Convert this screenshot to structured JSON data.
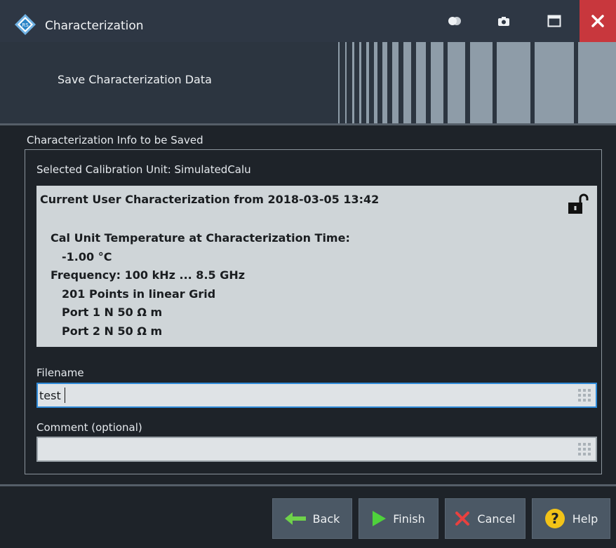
{
  "window": {
    "title": "Characterization",
    "controls": [
      "toggle-icon",
      "camera-icon",
      "maximize-icon",
      "close-icon"
    ],
    "close_color": "#c8373d"
  },
  "wizard": {
    "step_title": "Save Characterization Data"
  },
  "group": {
    "title": "Characterization Info to be Saved",
    "calibration_unit": "Selected Calibration Unit: SimulatedCalu",
    "info": {
      "heading": "Current User Characterization from 2018-03-05 13:42",
      "lines": [
        "Cal Unit Temperature at Characterization Time:",
        "-1.00 °C",
        "Frequency: 100 kHz ... 8.5 GHz",
        "201 Points in linear Grid",
        "Port 1 N 50 Ω m",
        "Port 2 N 50 Ω m"
      ],
      "lock_icon": "unlocked-padlock-icon"
    },
    "filename": {
      "label": "Filename",
      "value": "test"
    },
    "comment": {
      "label": "Comment (optional)",
      "value": ""
    }
  },
  "footer": {
    "back_label": "Back",
    "finish_label": "Finish",
    "cancel_label": "Cancel",
    "help_label": "Help"
  },
  "colors": {
    "accent": "#2f8ad8",
    "back_arrow": "#6fd24a",
    "finish_arrow": "#4fd23c",
    "cancel_x": "#e8413f",
    "help_circle": "#f2c318"
  }
}
